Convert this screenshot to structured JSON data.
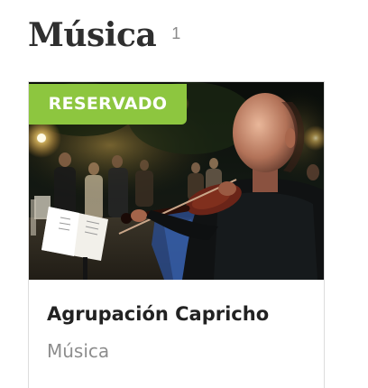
{
  "section": {
    "title": "Música",
    "count": "1"
  },
  "card": {
    "badge": "RESERVADO",
    "badge_color": "#8dc63f",
    "title": "Agrupación Capricho",
    "category": "Música",
    "image_alt": "Violinista tocando en un evento nocturno al aire libre"
  }
}
